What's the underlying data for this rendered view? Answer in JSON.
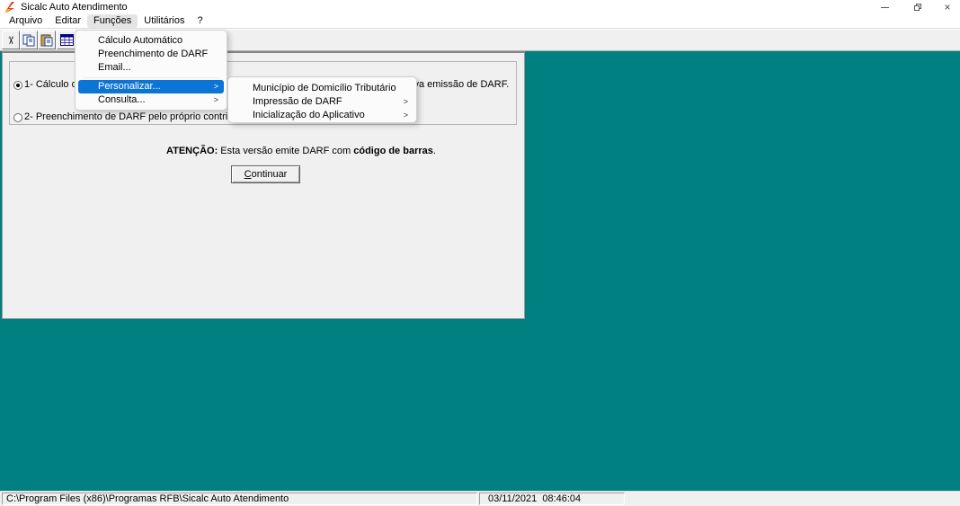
{
  "titlebar": {
    "title": "Sicalc Auto Atendimento"
  },
  "menubar": {
    "items": [
      {
        "label": "Arquivo"
      },
      {
        "label": "Editar"
      },
      {
        "label": "Funções",
        "pressed": true
      },
      {
        "label": "Utilitários"
      },
      {
        "label": "?"
      }
    ]
  },
  "toolbar": {
    "icons": [
      "cut-icon",
      "copy-icon",
      "paste-icon",
      "calc-table-icon"
    ]
  },
  "menu_funcoes": {
    "items": [
      {
        "label": "Cálculo Automático"
      },
      {
        "label": "Preenchimento de DARF"
      },
      {
        "label": "Email..."
      },
      {
        "label": "Personalizar...",
        "highlighted": true,
        "has_submenu": true
      },
      {
        "label": "Consulta...",
        "has_submenu": true
      }
    ]
  },
  "submenu_personalizar": {
    "items": [
      {
        "label": "Município de Domicílio Tributário"
      },
      {
        "label": "Impressão de DARF",
        "has_submenu": true
      },
      {
        "label": "Inicialização do Aplicativo",
        "has_submenu": true
      }
    ]
  },
  "main": {
    "option1": {
      "selected": true,
      "label_left": "1- Cálculo do",
      "label_right": "tiva emissão de DARF."
    },
    "option2": {
      "selected": false,
      "label": "2- Preenchimento de DARF pelo próprio contribuinte para a"
    },
    "attention": {
      "prefix": "ATENÇÃO:",
      "middle": " Esta versão emite DARF com ",
      "bold": "código de barras",
      "suffix": "."
    },
    "continue_button": {
      "accel": "C",
      "rest": "ontinuar"
    }
  },
  "statusbar": {
    "path": "C:\\Program Files (x86)\\Programas RFB\\Sicalc Auto Atendimento",
    "datetime": "03/11/2021  08:46:04"
  },
  "glyphs": {
    "cut": "✂",
    "submenu_arrow": ">",
    "close": "×"
  },
  "colors": {
    "desktop_teal": "#008080",
    "menu_highlight": "#0b74d4",
    "titlebar_bg": "#ffffff",
    "toolbar_bg": "#f0f0f0"
  }
}
